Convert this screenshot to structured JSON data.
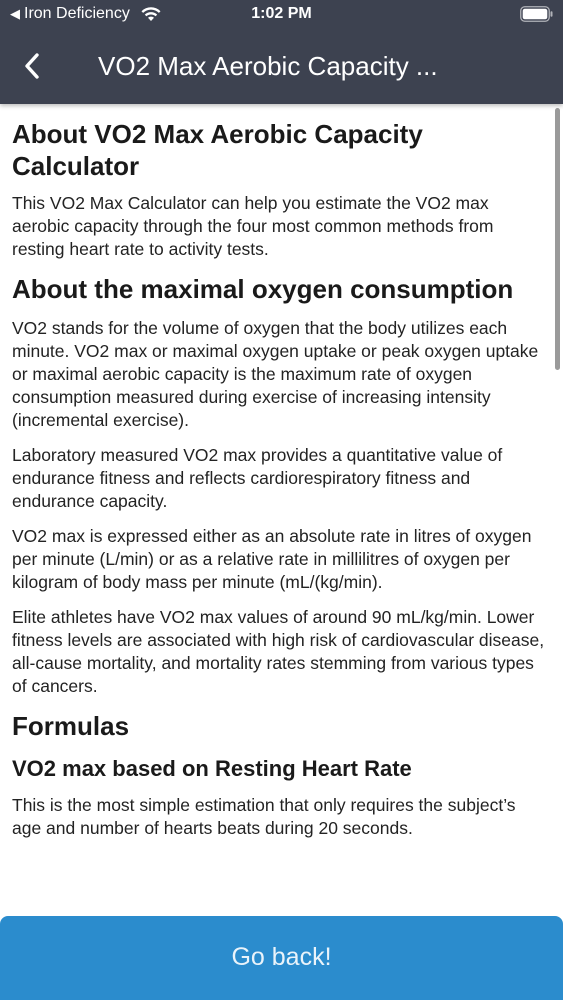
{
  "status_bar": {
    "back_app": "Iron Deficiency",
    "time": "1:02 PM"
  },
  "header": {
    "title": "VO2 Max Aerobic Capacity ..."
  },
  "content": {
    "heading_about": "About VO2 Max Aerobic Capacity Calculator",
    "intro": "This VO2 Max Calculator can help you estimate the VO2 max aerobic capacity through the four most common methods from resting heart rate to activity tests.",
    "heading_oxygen": "About the maximal oxygen consumption",
    "para1": "VO2 stands for the volume of oxygen that the body utilizes each minute. VO2 max or maximal oxygen uptake or peak oxygen uptake or maximal aerobic capacity is the maximum rate of oxygen consumption measured during exercise of increasing intensity (incremental exercise).",
    "para2": "Laboratory measured VO2 max provides a quantitative value of endurance fitness and reflects cardiorespiratory fitness and endurance capacity.",
    "para3": "VO2 max is expressed either as an absolute rate in litres of oxygen per minute (L/min) or as a relative rate in millilitres of oxygen per kilogram of body mass per minute (mL/(kg/min).",
    "para4": "Elite athletes have VO2 max values of around 90 mL/kg/min. Lower fitness levels are associated with high risk of cardiovascular disease, all-cause mortality, and mortality rates stemming from various types of cancers.",
    "heading_formulas": "Formulas",
    "heading_resting": "VO2 max based on Resting Heart Rate",
    "para5": "This is the most simple estimation that only requires the subject’s age and number of hearts beats during 20 seconds."
  },
  "footer": {
    "go_back_label": "Go back!"
  },
  "icons": {
    "status_back": "back-arrow-small-icon",
    "wifi": "wifi-icon",
    "battery": "battery-icon",
    "nav_back": "chevron-left-icon"
  },
  "colors": {
    "header_bg": "#3d4250",
    "button_bg": "#2b8ccd",
    "button_text": "#e9f3fa"
  }
}
